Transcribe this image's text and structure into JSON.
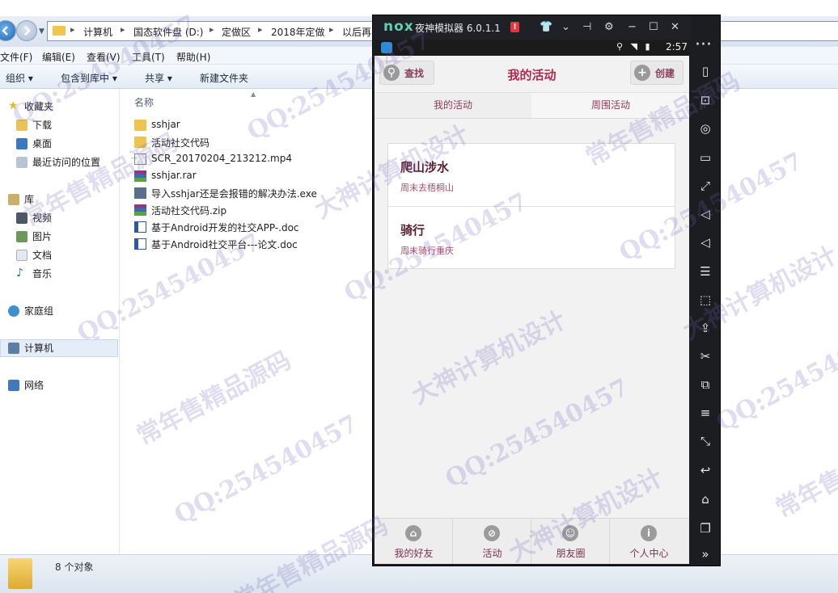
{
  "explorer": {
    "breadcrumbs": [
      "计算机",
      "国态软件盘 (D:)",
      "定做区",
      "2018年定做",
      "以后再"
    ],
    "menu": [
      "文件(F)",
      "编辑(E)",
      "查看(V)",
      "工具(T)",
      "帮助(H)"
    ],
    "toolbar": {
      "organize": "组织 ▾",
      "include_in_library": "包含到库中 ▾",
      "share": "共享 ▾",
      "new_folder": "新建文件夹"
    },
    "nav": {
      "favorites": "收藏夹",
      "downloads": "下载",
      "desktop": "桌面",
      "recent": "最近访问的位置",
      "library": "库",
      "videos": "视频",
      "pictures": "图片",
      "documents": "文档",
      "music": "音乐",
      "homegroup": "家庭组",
      "computer": "计算机",
      "network": "网络"
    },
    "column_name": "名称",
    "files": [
      {
        "name": "sshjar",
        "type": "folder"
      },
      {
        "name": "活动社交代码",
        "type": "folder"
      },
      {
        "name": "SCR_20170204_213212.mp4",
        "type": "video"
      },
      {
        "name": "sshjar.rar",
        "type": "archive"
      },
      {
        "name": "导入sshjar还是会报错的解决办法.exe",
        "type": "exe"
      },
      {
        "name": "活动社交代码.zip",
        "type": "archive"
      },
      {
        "name": "基于Android开发的社交APP-.doc",
        "type": "doc"
      },
      {
        "name": "基于Android社交平台---论文.doc",
        "type": "doc"
      }
    ],
    "status": "8 个对象"
  },
  "emulator": {
    "logo": "nox",
    "title": "夜神模拟器 6.0.1.1",
    "badge": "!",
    "status_time": "2:57",
    "app": {
      "search_label": "查找",
      "title": "我的活动",
      "create_label": "创建",
      "tabs": [
        "我的活动",
        "周围活动"
      ],
      "activities": [
        {
          "title": "爬山涉水",
          "subtitle": "周末去梧桐山"
        },
        {
          "title": "骑行",
          "subtitle": "周末骑行重庆"
        }
      ],
      "bottom_nav": [
        "我的好友",
        "活动",
        "朋友圈",
        "个人中心"
      ]
    }
  },
  "watermarks": {
    "qq": "QQ:254540457",
    "design": "大神计算机设计",
    "source": "常年售精品源码"
  },
  "colors": {
    "accent": "#b1294b",
    "nox_green": "#5fd0b2",
    "emulator_frame": "#1b1d21",
    "explorer_toolbar": "#e2ebf5"
  }
}
